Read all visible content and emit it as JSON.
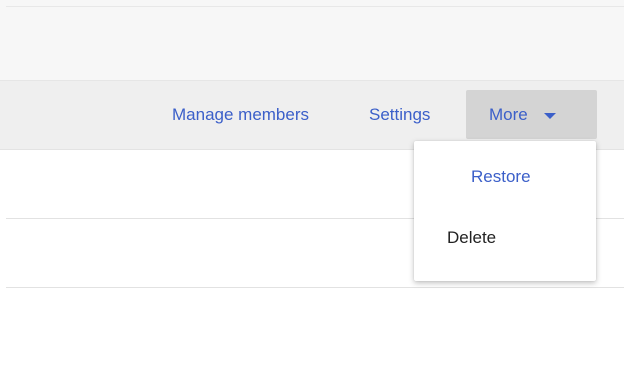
{
  "toolbar": {
    "manage_members_label": "Manage members",
    "settings_label": "Settings",
    "more_label": "More"
  },
  "more_menu": {
    "items": [
      {
        "label": "Restore"
      },
      {
        "label": "Delete"
      }
    ]
  },
  "icons": {
    "more_dropdown": "caret-down-icon"
  },
  "colors": {
    "link": "#3b5fc9",
    "menu_text": "#222222",
    "more_button_bg": "#d4d4d4",
    "toolbar_bg": "#efefef"
  }
}
